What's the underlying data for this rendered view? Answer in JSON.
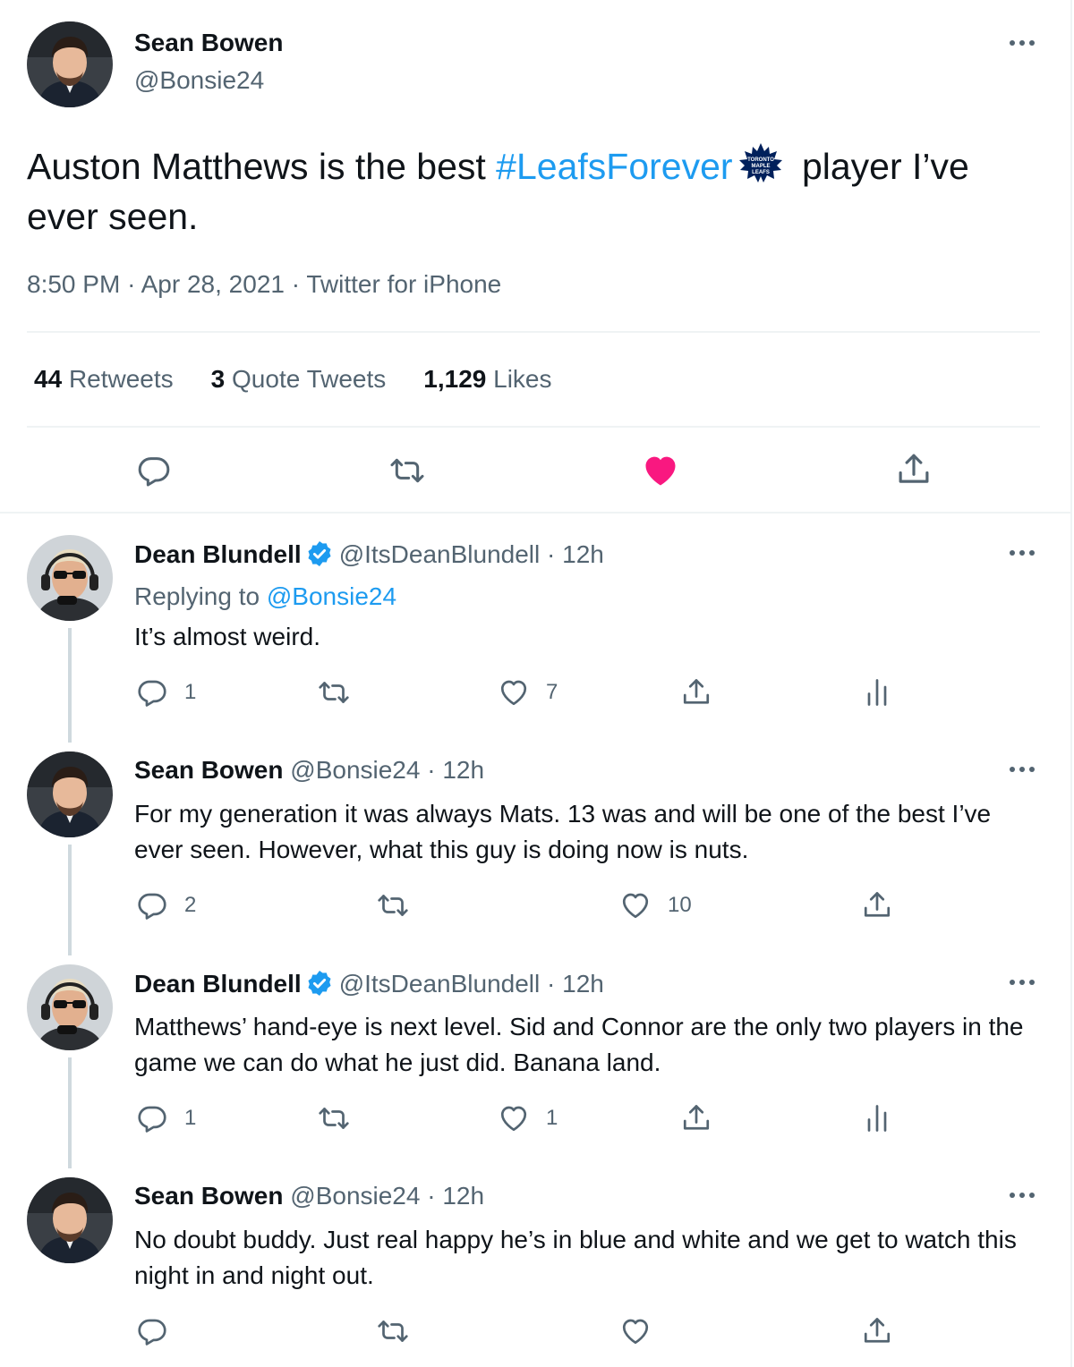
{
  "main_tweet": {
    "author_name": "Sean Bowen",
    "author_handle": "@Bonsie24",
    "text_before": "Auston Matthews is the best",
    "hashtag": "#LeafsForever",
    "hashtag_emoji_icon": "maple-leafs-logo-icon",
    "text_after": "player I’ve ever seen.",
    "time": "8:50 PM",
    "date": "Apr 28, 2021",
    "source": "Twitter for iPhone",
    "retweets_count": "44",
    "retweets_label": "Retweets",
    "quote_count": "3",
    "quote_label": "Quote Tweets",
    "likes_count": "1,129",
    "likes_label": "Likes",
    "liked": true
  },
  "replies": [
    {
      "author_name": "Dean Blundell",
      "verified": true,
      "author_handle": "@ItsDeanBlundell",
      "time": "12h",
      "replying_label": "Replying to",
      "replying_to": "@Bonsie24",
      "text": "It’s almost weird.",
      "reply_count": "1",
      "retweet_count": "",
      "like_count": "7"
    },
    {
      "author_name": "Sean Bowen",
      "verified": false,
      "author_handle": "@Bonsie24",
      "time": "12h",
      "text": "For my generation it was always Mats. 13 was and will be one of the best I’ve ever seen. However, what this guy is doing now is nuts.",
      "reply_count": "2",
      "retweet_count": "",
      "like_count": "10"
    },
    {
      "author_name": "Dean Blundell",
      "verified": true,
      "author_handle": "@ItsDeanBlundell",
      "time": "12h",
      "text": "Matthews’ hand-eye is next level.  Sid and Connor are the only two players in the game we can do what he just did. Banana land.",
      "reply_count": "1",
      "retweet_count": "",
      "like_count": "1"
    },
    {
      "author_name": "Sean Bowen",
      "verified": false,
      "author_handle": "@Bonsie24",
      "time": "12h",
      "text": "No doubt buddy. Just real happy he’s in blue and white and we get to watch this night in and night out.",
      "reply_count": "",
      "retweet_count": "",
      "like_count": ""
    }
  ],
  "colors": {
    "link": "#1d9bf0",
    "muted": "#536471",
    "like_active": "#f91880",
    "thread_line": "#cfd9de",
    "verified": "#1d9bf0"
  }
}
